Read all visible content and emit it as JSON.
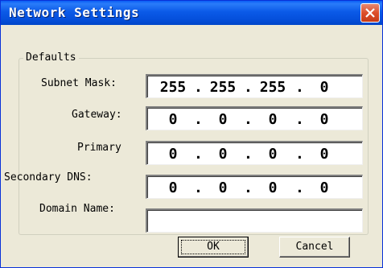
{
  "window": {
    "title": "Network Settings"
  },
  "group": {
    "label": "Defaults"
  },
  "fields": {
    "subnet_mask": {
      "label": "Subnet Mask:",
      "octets": [
        "255",
        "255",
        "255",
        "0"
      ]
    },
    "gateway": {
      "label": "Gateway:",
      "octets": [
        "0",
        "0",
        "0",
        "0"
      ]
    },
    "primary": {
      "label": "Primary",
      "octets": [
        "0",
        "0",
        "0",
        "0"
      ]
    },
    "secondary_dns": {
      "label": "Secondary DNS:",
      "octets": [
        "0",
        "0",
        "0",
        "0"
      ]
    },
    "domain_name": {
      "label": "Domain Name:",
      "value": ""
    }
  },
  "separator": ".",
  "buttons": {
    "ok": "OK",
    "cancel": "Cancel"
  }
}
